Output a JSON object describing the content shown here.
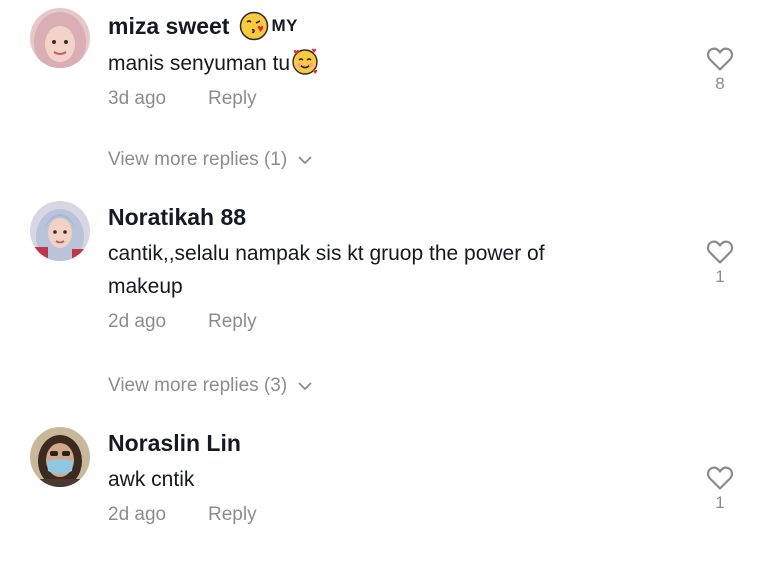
{
  "comments": [
    {
      "username": "miza sweet",
      "username_emoji": "face-blowing-kiss-emoji",
      "country_badge": "MY",
      "text": "manis senyuman tu",
      "text_emoji": "smiling-face-with-hearts-emoji",
      "date": "3d ago",
      "reply_label": "Reply",
      "like_count": "8",
      "view_more": "View more replies (1)"
    },
    {
      "username": "Noratikah 88",
      "text": "cantik,,selalu nampak sis kt gruop the power of makeup",
      "date": "2d ago",
      "reply_label": "Reply",
      "like_count": "1",
      "view_more": "View more replies (3)"
    },
    {
      "username": "Noraslin Lin",
      "text": "awk cntik",
      "date": "2d ago",
      "reply_label": "Reply",
      "like_count": "1"
    }
  ],
  "colors": {
    "text": "#161823",
    "muted": "rgba(22,24,35,0.5)",
    "background": "#ffffff"
  },
  "icons": {
    "like": "heart-outline-icon",
    "expand": "chevron-down-icon"
  }
}
